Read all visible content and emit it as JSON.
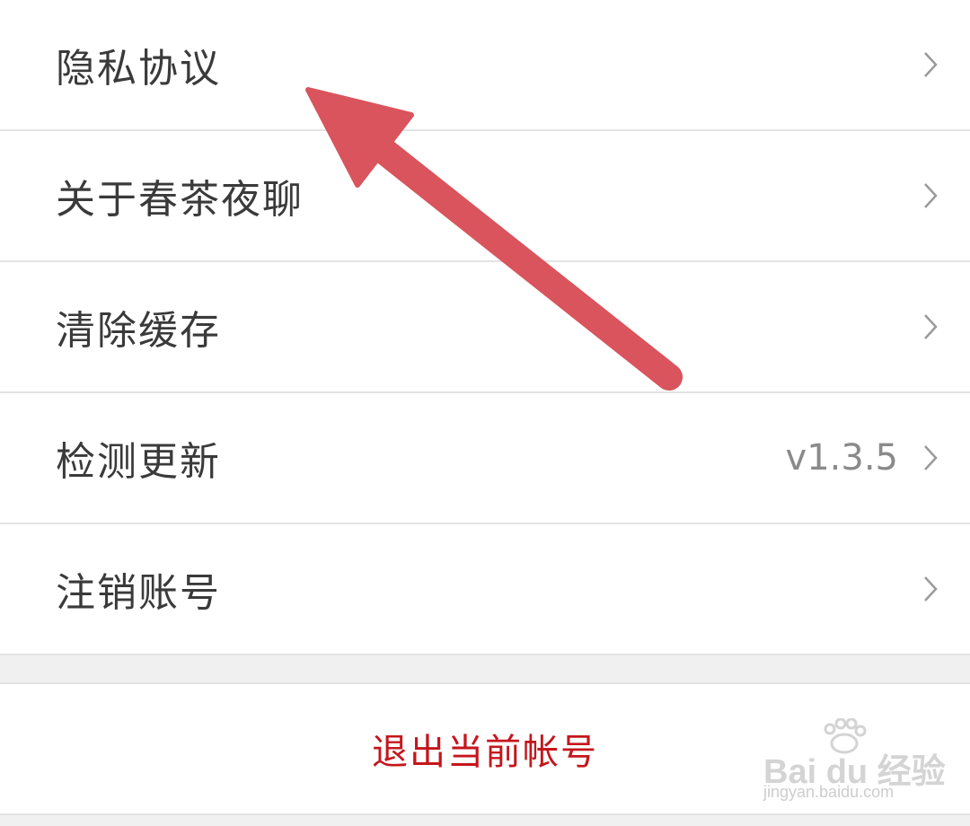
{
  "settings": {
    "items": [
      {
        "label": "隐私协议",
        "value": ""
      },
      {
        "label": "关于春茶夜聊",
        "value": ""
      },
      {
        "label": "清除缓存",
        "value": ""
      },
      {
        "label": "检测更新",
        "value": "v1.3.5"
      },
      {
        "label": "注销账号",
        "value": ""
      }
    ],
    "logout_label": "退出当前帐号"
  },
  "annotation": {
    "arrow_color": "#d9545c"
  },
  "watermark": {
    "logo_text": "Bai du 经验",
    "url": "jingyan.baidu.com"
  },
  "colors": {
    "logout": "#c4161c",
    "label": "#3a3a3a",
    "value": "#8a8a8a",
    "divider": "#e3e3e3"
  }
}
